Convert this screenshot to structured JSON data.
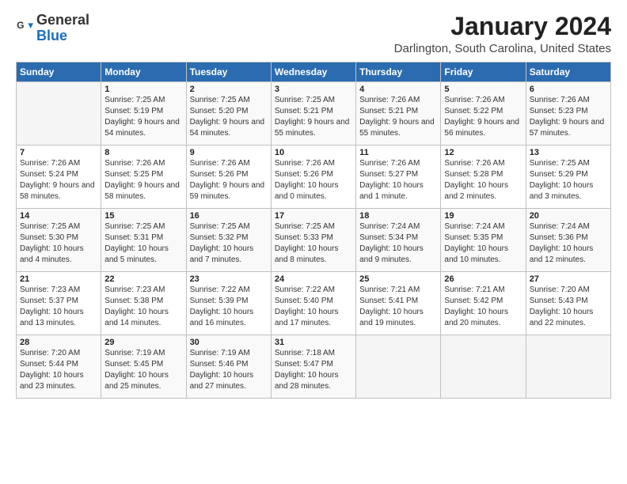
{
  "logo": {
    "general": "General",
    "blue": "Blue"
  },
  "title": "January 2024",
  "location": "Darlington, South Carolina, United States",
  "headers": [
    "Sunday",
    "Monday",
    "Tuesday",
    "Wednesday",
    "Thursday",
    "Friday",
    "Saturday"
  ],
  "weeks": [
    [
      {
        "day": "",
        "sunrise": "",
        "sunset": "",
        "daylight": ""
      },
      {
        "day": "1",
        "sunrise": "Sunrise: 7:25 AM",
        "sunset": "Sunset: 5:19 PM",
        "daylight": "Daylight: 9 hours and 54 minutes."
      },
      {
        "day": "2",
        "sunrise": "Sunrise: 7:25 AM",
        "sunset": "Sunset: 5:20 PM",
        "daylight": "Daylight: 9 hours and 54 minutes."
      },
      {
        "day": "3",
        "sunrise": "Sunrise: 7:25 AM",
        "sunset": "Sunset: 5:21 PM",
        "daylight": "Daylight: 9 hours and 55 minutes."
      },
      {
        "day": "4",
        "sunrise": "Sunrise: 7:26 AM",
        "sunset": "Sunset: 5:21 PM",
        "daylight": "Daylight: 9 hours and 55 minutes."
      },
      {
        "day": "5",
        "sunrise": "Sunrise: 7:26 AM",
        "sunset": "Sunset: 5:22 PM",
        "daylight": "Daylight: 9 hours and 56 minutes."
      },
      {
        "day": "6",
        "sunrise": "Sunrise: 7:26 AM",
        "sunset": "Sunset: 5:23 PM",
        "daylight": "Daylight: 9 hours and 57 minutes."
      }
    ],
    [
      {
        "day": "7",
        "sunrise": "Sunrise: 7:26 AM",
        "sunset": "Sunset: 5:24 PM",
        "daylight": "Daylight: 9 hours and 58 minutes."
      },
      {
        "day": "8",
        "sunrise": "Sunrise: 7:26 AM",
        "sunset": "Sunset: 5:25 PM",
        "daylight": "Daylight: 9 hours and 58 minutes."
      },
      {
        "day": "9",
        "sunrise": "Sunrise: 7:26 AM",
        "sunset": "Sunset: 5:26 PM",
        "daylight": "Daylight: 9 hours and 59 minutes."
      },
      {
        "day": "10",
        "sunrise": "Sunrise: 7:26 AM",
        "sunset": "Sunset: 5:26 PM",
        "daylight": "Daylight: 10 hours and 0 minutes."
      },
      {
        "day": "11",
        "sunrise": "Sunrise: 7:26 AM",
        "sunset": "Sunset: 5:27 PM",
        "daylight": "Daylight: 10 hours and 1 minute."
      },
      {
        "day": "12",
        "sunrise": "Sunrise: 7:26 AM",
        "sunset": "Sunset: 5:28 PM",
        "daylight": "Daylight: 10 hours and 2 minutes."
      },
      {
        "day": "13",
        "sunrise": "Sunrise: 7:25 AM",
        "sunset": "Sunset: 5:29 PM",
        "daylight": "Daylight: 10 hours and 3 minutes."
      }
    ],
    [
      {
        "day": "14",
        "sunrise": "Sunrise: 7:25 AM",
        "sunset": "Sunset: 5:30 PM",
        "daylight": "Daylight: 10 hours and 4 minutes."
      },
      {
        "day": "15",
        "sunrise": "Sunrise: 7:25 AM",
        "sunset": "Sunset: 5:31 PM",
        "daylight": "Daylight: 10 hours and 5 minutes."
      },
      {
        "day": "16",
        "sunrise": "Sunrise: 7:25 AM",
        "sunset": "Sunset: 5:32 PM",
        "daylight": "Daylight: 10 hours and 7 minutes."
      },
      {
        "day": "17",
        "sunrise": "Sunrise: 7:25 AM",
        "sunset": "Sunset: 5:33 PM",
        "daylight": "Daylight: 10 hours and 8 minutes."
      },
      {
        "day": "18",
        "sunrise": "Sunrise: 7:24 AM",
        "sunset": "Sunset: 5:34 PM",
        "daylight": "Daylight: 10 hours and 9 minutes."
      },
      {
        "day": "19",
        "sunrise": "Sunrise: 7:24 AM",
        "sunset": "Sunset: 5:35 PM",
        "daylight": "Daylight: 10 hours and 10 minutes."
      },
      {
        "day": "20",
        "sunrise": "Sunrise: 7:24 AM",
        "sunset": "Sunset: 5:36 PM",
        "daylight": "Daylight: 10 hours and 12 minutes."
      }
    ],
    [
      {
        "day": "21",
        "sunrise": "Sunrise: 7:23 AM",
        "sunset": "Sunset: 5:37 PM",
        "daylight": "Daylight: 10 hours and 13 minutes."
      },
      {
        "day": "22",
        "sunrise": "Sunrise: 7:23 AM",
        "sunset": "Sunset: 5:38 PM",
        "daylight": "Daylight: 10 hours and 14 minutes."
      },
      {
        "day": "23",
        "sunrise": "Sunrise: 7:22 AM",
        "sunset": "Sunset: 5:39 PM",
        "daylight": "Daylight: 10 hours and 16 minutes."
      },
      {
        "day": "24",
        "sunrise": "Sunrise: 7:22 AM",
        "sunset": "Sunset: 5:40 PM",
        "daylight": "Daylight: 10 hours and 17 minutes."
      },
      {
        "day": "25",
        "sunrise": "Sunrise: 7:21 AM",
        "sunset": "Sunset: 5:41 PM",
        "daylight": "Daylight: 10 hours and 19 minutes."
      },
      {
        "day": "26",
        "sunrise": "Sunrise: 7:21 AM",
        "sunset": "Sunset: 5:42 PM",
        "daylight": "Daylight: 10 hours and 20 minutes."
      },
      {
        "day": "27",
        "sunrise": "Sunrise: 7:20 AM",
        "sunset": "Sunset: 5:43 PM",
        "daylight": "Daylight: 10 hours and 22 minutes."
      }
    ],
    [
      {
        "day": "28",
        "sunrise": "Sunrise: 7:20 AM",
        "sunset": "Sunset: 5:44 PM",
        "daylight": "Daylight: 10 hours and 23 minutes."
      },
      {
        "day": "29",
        "sunrise": "Sunrise: 7:19 AM",
        "sunset": "Sunset: 5:45 PM",
        "daylight": "Daylight: 10 hours and 25 minutes."
      },
      {
        "day": "30",
        "sunrise": "Sunrise: 7:19 AM",
        "sunset": "Sunset: 5:46 PM",
        "daylight": "Daylight: 10 hours and 27 minutes."
      },
      {
        "day": "31",
        "sunrise": "Sunrise: 7:18 AM",
        "sunset": "Sunset: 5:47 PM",
        "daylight": "Daylight: 10 hours and 28 minutes."
      },
      {
        "day": "",
        "sunrise": "",
        "sunset": "",
        "daylight": ""
      },
      {
        "day": "",
        "sunrise": "",
        "sunset": "",
        "daylight": ""
      },
      {
        "day": "",
        "sunrise": "",
        "sunset": "",
        "daylight": ""
      }
    ]
  ]
}
